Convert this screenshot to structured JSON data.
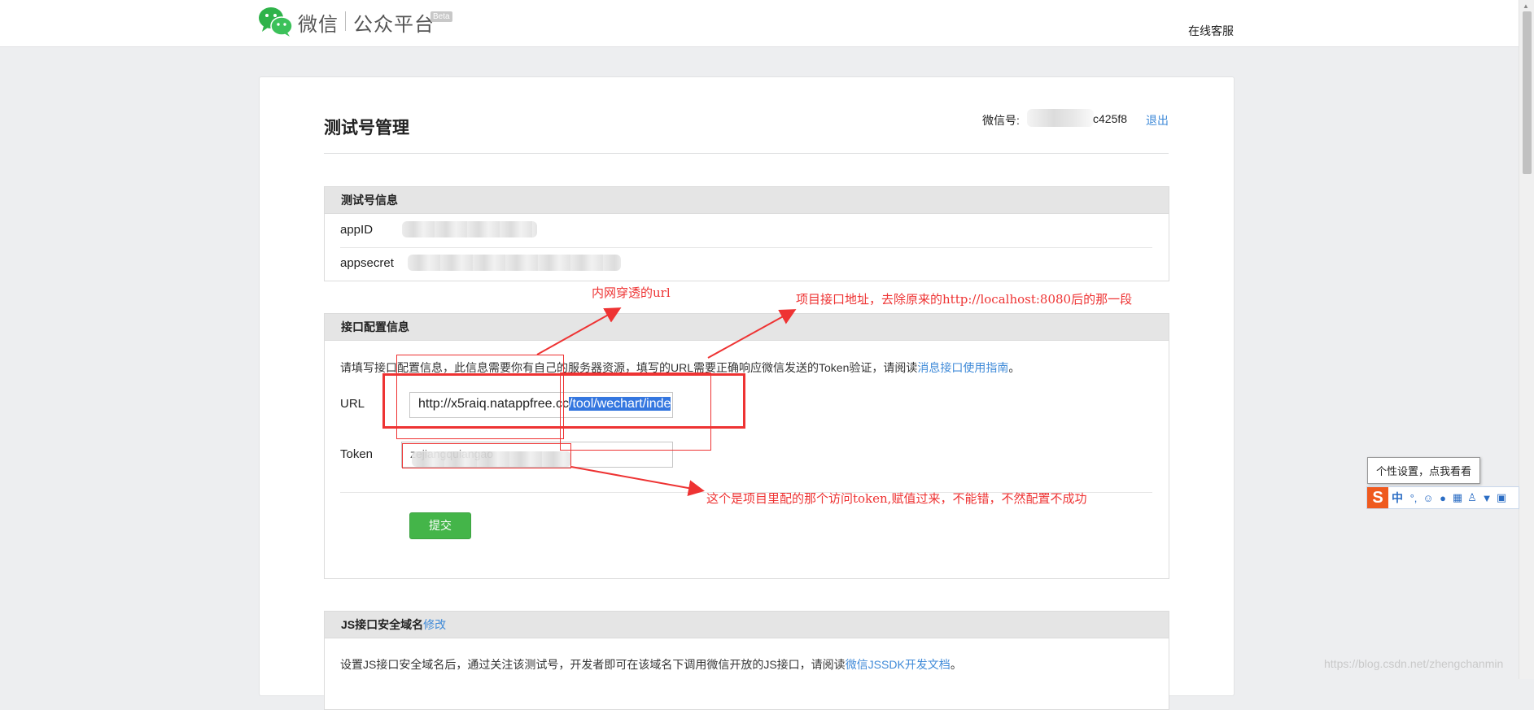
{
  "header": {
    "logo_text": "微信",
    "platform_name": "公众平台",
    "beta_badge": "Beta",
    "support_link": "在线客服"
  },
  "page": {
    "title": "测试号管理",
    "wechat_id_label": "微信号:",
    "wechat_id_visible": "c425f8",
    "logout": "退出"
  },
  "test_account_panel": {
    "title": "测试号信息",
    "appid_label": "appID",
    "appsecret_label": "appsecret"
  },
  "interface_panel": {
    "title": "接口配置信息",
    "description": "请填写接口配置信息，此信息需要你有自己的服务器资源，填写的URL需要正确响应微信发送的Token验证，请阅读",
    "description_link": "消息接口使用指南",
    "description_end": "。",
    "url_label": "URL",
    "url_value_plain": "http://x5raiq.natappfree.cc",
    "url_value_selected": "/tool/wechart/inde",
    "token_label": "Token",
    "token_value": "zejiangquiangao",
    "submit": "提交"
  },
  "js_panel": {
    "title": "JS接口安全域名",
    "edit_link": "修改",
    "description": "设置JS接口安全域名后，通过关注该测试号，开发者即可在该域名下调用微信开放的JS接口，请阅读",
    "description_link": "微信JSSDK开发文档",
    "description_end": "。"
  },
  "annotations": {
    "tunnel": "内网穿透的url",
    "project": "项目接口地址，去除原来的http://localhost:8080后的那一段",
    "token": "这个是项目里配的那个访问token,赋值过来，不能错，不然配置不成功"
  },
  "ime": {
    "tooltip": "个性设置，点我看看",
    "logo": "S",
    "mode": "中",
    "icons": [
      "punctuation-icon",
      "emoji-icon",
      "voice-icon",
      "keyboard-icon",
      "user-icon",
      "skin-icon",
      "toolbox-icon"
    ]
  },
  "watermark": "https://blog.csdn.net/zhengchanmin",
  "colors": {
    "link": "#3f8ad8",
    "submit": "#44b549",
    "annotation": "#ee3333",
    "selection": "#3577e0"
  }
}
